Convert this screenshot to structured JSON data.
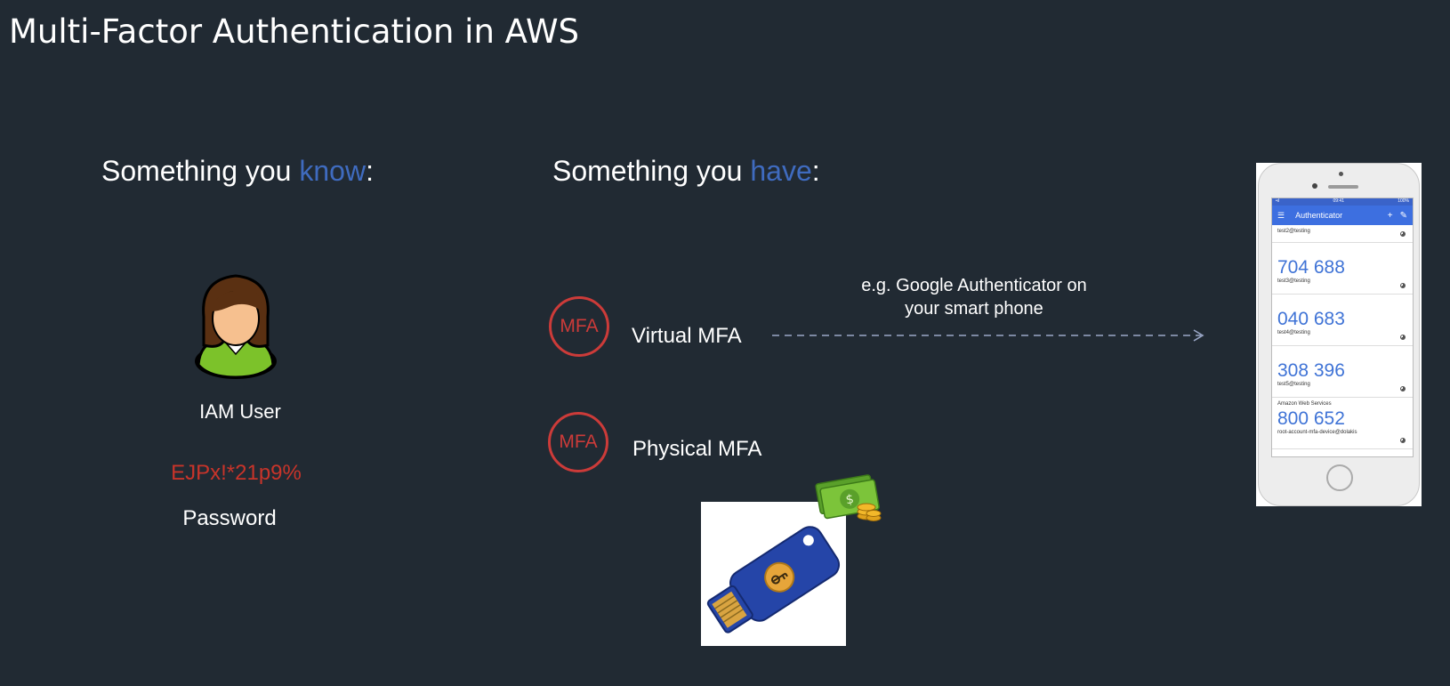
{
  "slide": {
    "title": "Multi-Factor Authentication in AWS"
  },
  "know_section": {
    "heading_prefix": "Something you ",
    "heading_accent": "know",
    "heading_suffix": ":",
    "user_label": "IAM User",
    "password_value": "EJPx!*21p9%",
    "password_label": "Password"
  },
  "have_section": {
    "heading_prefix": "Something you ",
    "heading_accent": "have",
    "heading_suffix": ":",
    "virtual": {
      "badge_text": "MFA",
      "label": "Virtual MFA",
      "note_line1": "e.g. Google Authenticator on",
      "note_line2": "your smart phone"
    },
    "physical": {
      "badge_text": "MFA",
      "label": "Physical MFA"
    }
  },
  "phone_screen": {
    "status_left": "•ıl",
    "status_center": "09:41",
    "status_right": "100%",
    "app_title": "Authenticator",
    "entries": [
      {
        "code": "",
        "account": "test2@testing"
      },
      {
        "code": "704 688",
        "account": "test3@testing"
      },
      {
        "code": "040 683",
        "account": "test4@testing"
      },
      {
        "code": "308 396",
        "account": "test5@testing"
      },
      {
        "code": "800 652",
        "issuer": "Amazon Web Services",
        "account": "root-account-mfa-device@dolakis"
      }
    ]
  },
  "colors": {
    "background": "#212a33",
    "accent_blue": "#3f6bbf",
    "password_red": "#c8342a",
    "mfa_red": "#cc3b39"
  },
  "icons": [
    "user-avatar-icon",
    "mfa-badge-icon",
    "usb-security-key-icon",
    "cash-coins-icon",
    "smartphone-icon"
  ]
}
